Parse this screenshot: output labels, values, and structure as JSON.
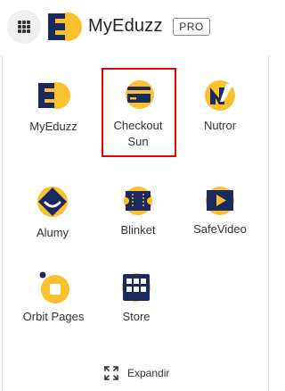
{
  "header": {
    "brand": "MyEduzz",
    "badge": "PRO"
  },
  "apps": [
    {
      "label": "MyEduzz",
      "icon": "myeduzz-icon"
    },
    {
      "label": "Checkout Sun",
      "icon": "checkout-card-icon",
      "selected": true
    },
    {
      "label": "Nutror",
      "icon": "nutror-icon"
    },
    {
      "label": "Alumy",
      "icon": "alumy-icon"
    },
    {
      "label": "Blinket",
      "icon": "blinket-icon"
    },
    {
      "label": "SafeVideo",
      "icon": "safevideo-icon"
    },
    {
      "label": "Orbit Pages",
      "icon": "orbit-pages-icon"
    },
    {
      "label": "Store",
      "icon": "store-icon"
    }
  ],
  "footer": {
    "expand_label": "Expandir"
  },
  "colors": {
    "yellow": "#fbc02d",
    "navy": "#1b2a5e",
    "selected_border": "#e60000"
  }
}
